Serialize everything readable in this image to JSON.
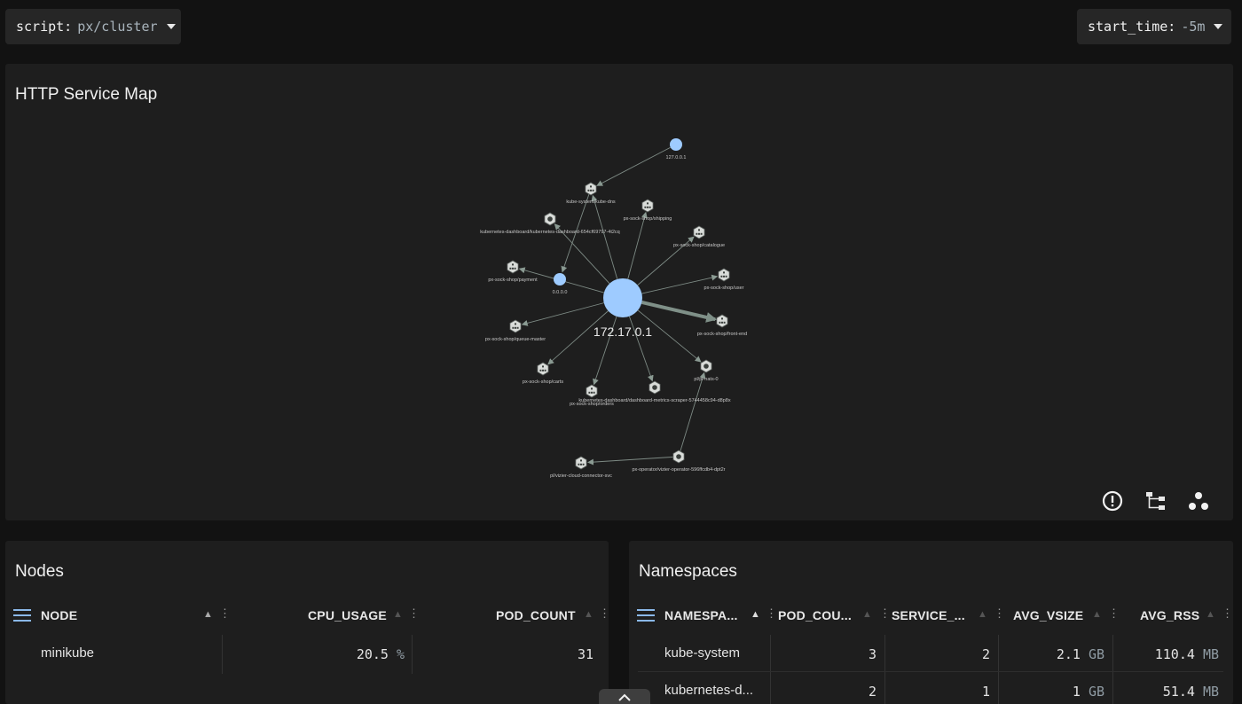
{
  "toolbar": {
    "script_key": "script:",
    "script_value": "px/cluster",
    "start_time_key": "start_time:",
    "start_time_value": "-5m"
  },
  "service_map": {
    "title": "HTTP Service Map",
    "center_label": "172.17.0.1",
    "node_labels": {
      "ip_127": "127.0.0.1",
      "kube_dns": "kube-system/kube-dns",
      "k8s_dash": "kubernetes-dashboard/kubernetes-dashboard-654cf69797-4t2cq",
      "shipping": "px-sock-shop/shipping",
      "catalogue": "px-sock-shop/catalogue",
      "payment": "px-sock-shop/payment",
      "ip_0000": "0.0.0.0",
      "user": "px-sock-shop/user",
      "front_end": "px-sock-shop/front-end",
      "queue_master": "px-sock-shop/queue-master",
      "pl_nats": "pl/pl-nats-0",
      "carts": "px-sock-shop/carts",
      "orders": "px-sock-shop/orders",
      "metrics_scraper": "kubernetes-dashboard/dashboard-metrics-scraper-5744458c94-d8p8x",
      "vizier_op": "px-operator/vizier-operator-596ffcdb4-dpt2r",
      "cloud_conn": "pl/vizier-cloud-connector-svc"
    }
  },
  "nodes_table": {
    "title": "Nodes",
    "columns": [
      "NODE",
      "CPU_USAGE",
      "POD_COUNT"
    ],
    "rows": [
      {
        "node": "minikube",
        "cpu_usage": "20.5",
        "cpu_unit": "%",
        "pod_count": "31"
      }
    ]
  },
  "namespaces_table": {
    "title": "Namespaces",
    "columns": [
      "NAMESPA...",
      "POD_COU...",
      "SERVICE_...",
      "AVG_VSIZE",
      "AVG_RSS"
    ],
    "rows": [
      {
        "namespace": "kube-system",
        "pod_count": "3",
        "service_count": "2",
        "avg_vsize": "2.1",
        "vsize_unit": "GB",
        "avg_rss": "110.4",
        "rss_unit": "MB"
      },
      {
        "namespace": "kubernetes-d...",
        "pod_count": "2",
        "service_count": "1",
        "avg_vsize": "1",
        "vsize_unit": "GB",
        "avg_rss": "51.4",
        "rss_unit": "MB"
      }
    ]
  }
}
